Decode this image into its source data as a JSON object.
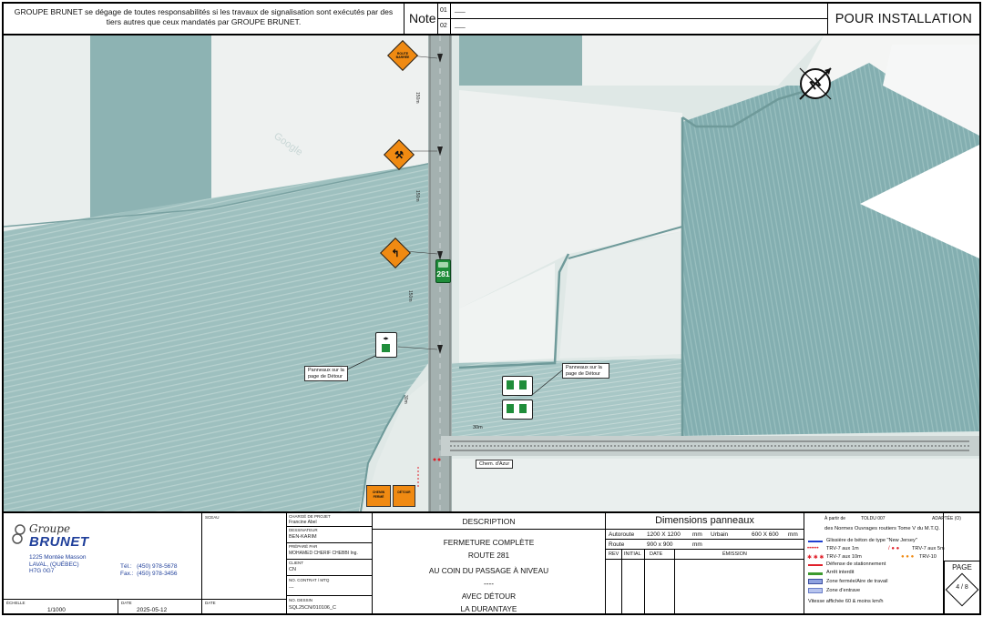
{
  "header": {
    "disclaimer": "GROUPE BRUNET se dégage de toutes responsabilités si les travaux de signalisation sont exécutés par des tiers autres que ceux mandatés par GROUPE BRUNET.",
    "note_label": "Note",
    "revisions": [
      {
        "num": "01",
        "text": "___"
      },
      {
        "num": "02",
        "text": "___"
      }
    ],
    "status": "POUR INSTALLATION"
  },
  "map": {
    "watermark": "Google",
    "route_number": "281",
    "callout_left": "Panneaux sur la page de Détour",
    "callout_right": "Panneaux sur la page de Détour",
    "street_label": "Chem. d'Azur",
    "distance_30m": "30m",
    "distance_labels": [
      "150m",
      "150m",
      "150m",
      "30m"
    ],
    "sign_texts": {
      "route_barree": "ROUTE BARRÉE",
      "detour_sign": "DÉTOUR",
      "barricade_1": "CHEMIN FERMÉ",
      "barricade_2": "DÉTOUR"
    }
  },
  "title_block": {
    "company_line1": "Groupe",
    "company_line2": "BRUNET",
    "address_lines": [
      "1225 Montée Masson",
      "LAVAL, (QUÉBEC)",
      "H7G 0G7"
    ],
    "tel_label": "Tél.:",
    "tel": "(450) 978-5678",
    "fax_label": "Fax.:",
    "fax": "(450) 978-3456",
    "sceau_label": "SCEAU",
    "scale_label": "ÉCHELLE",
    "scale": "1/1000",
    "date_label": "DATE",
    "date": "2025-05-12",
    "date2_label": "DATE",
    "project_lead_label": "CHARGÉ DE PROJET",
    "project_lead": "Francine Abel",
    "drafter_label": "DESSINATEUR",
    "drafter": "BEN-KARIM",
    "prepared_label": "PRÉPARÉ PAR",
    "prepared": "MOHAMED CHERIF CHEBBI Ing.",
    "client_label": "CLIENT",
    "client": "CN",
    "contract_label": "NO. CONTRAT / MTQ",
    "contract": "---",
    "drawing_label": "NO. DESSIN",
    "drawing": "SQL25CN/010106_C",
    "description_head": "DESCRIPTION",
    "description_lines": [
      "FERMETURE COMPLÈTE",
      "ROUTE 281",
      "AU COIN DU PASSAGE À NIVEAU",
      "----",
      "AVEC DÉTOUR",
      "LA DURANTAYE"
    ],
    "dimensions_head": "Dimensions panneaux",
    "dim_rows": [
      {
        "label": "Autoroute",
        "value": "1200 X 1200",
        "unit": "mm",
        "label2": "Urbain",
        "value2": "600 X 600",
        "unit2": "mm"
      },
      {
        "label": "Route",
        "value": "900 x 900",
        "unit": "mm",
        "label2": "",
        "value2": "",
        "unit2": ""
      }
    ],
    "rev_cols": [
      "REV",
      "INITIAL",
      "DATE",
      "ÉMISSION"
    ],
    "legend_head_a": "À partir de",
    "legend_head_b": "TOLDU 007",
    "legend_head_c": "ADAPTÉE (O)",
    "legend_head_d": "des Normes Ouvrages routiers Tome V du M.T.Q.",
    "legend_items": [
      {
        "text": "Glissière de béton de type \"New Jersey\"",
        "color": "#1f3fd0"
      },
      {
        "text": "TRV-7 aux 1m",
        "color": "#e0202a"
      },
      {
        "text": "TRV-7 aux 5m",
        "color": "#e0202a"
      },
      {
        "text": "TRV-7 aux 10m",
        "color": "#e0202a"
      },
      {
        "text": "TRV-10",
        "color": "#f08a12"
      },
      {
        "text": "Défense de stationnement",
        "color": "#e0202a"
      },
      {
        "text": "Arrêt interdit",
        "color": "#3c9a2e"
      },
      {
        "text": "Zone fermée/Aire de travail",
        "color": "#8fa2e0"
      },
      {
        "text": "Zone d'entrave",
        "color": "#b7c4ee"
      },
      {
        "text": "Vitesse affichée 60 & moins km/h",
        "color": "#333333"
      }
    ],
    "page_label": "PAGE",
    "page": "4 / 8"
  },
  "colors": {
    "field_dark": "#8fb3b3",
    "field_light": "#e7eceb",
    "sign_orange": "#f08a12",
    "route_green": "#1f8d3a",
    "brand_blue": "#1f3f9a"
  }
}
